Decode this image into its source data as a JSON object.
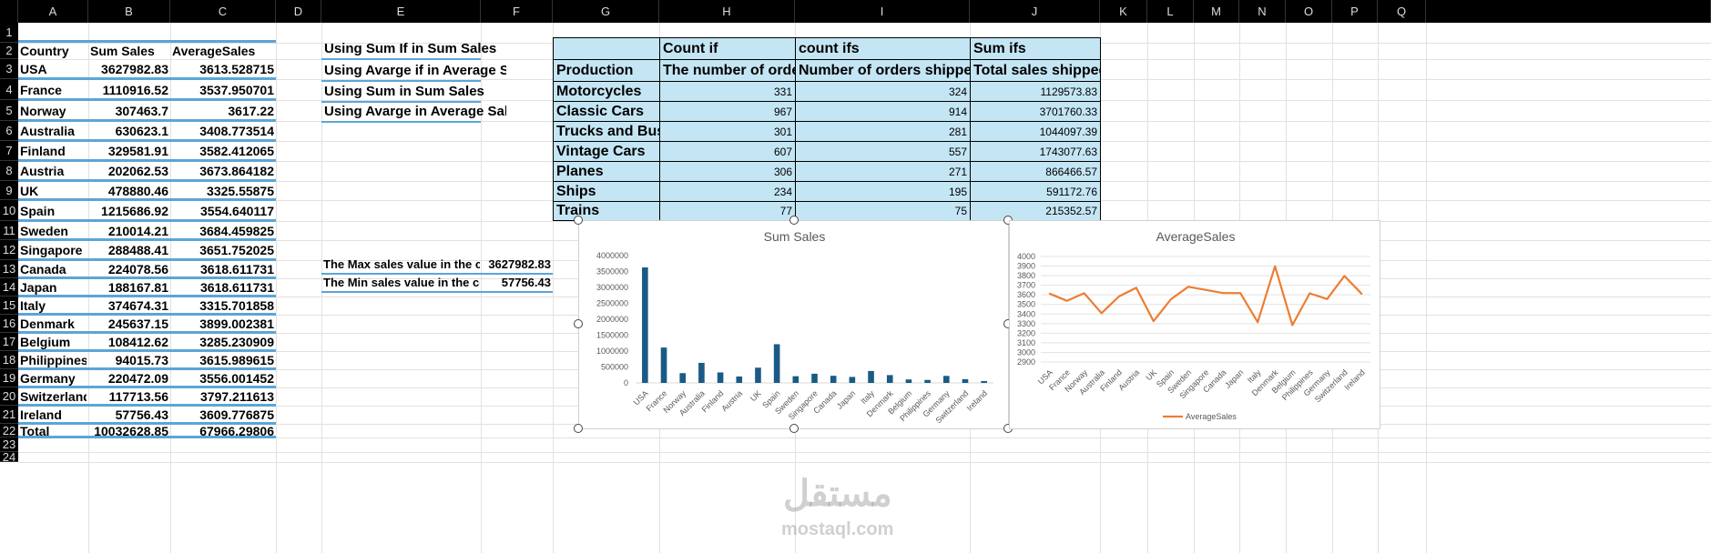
{
  "columns": [
    "A",
    "B",
    "C",
    "D",
    "E",
    "F",
    "G",
    "H",
    "I",
    "J",
    "K",
    "L",
    "M",
    "N",
    "O",
    "P",
    "Q"
  ],
  "rows": [
    "1",
    "2",
    "3",
    "4",
    "5",
    "6",
    "7",
    "8",
    "9",
    "10",
    "11",
    "12",
    "13",
    "14",
    "15",
    "16",
    "17",
    "18",
    "19",
    "20",
    "21",
    "22",
    "23",
    "24"
  ],
  "table_headers": {
    "country": "Country",
    "sum": "Sum Sales",
    "avg": "AverageSales"
  },
  "countries": [
    {
      "name": "USA",
      "sum": "3627982.83",
      "avg": "3613.528715"
    },
    {
      "name": "France",
      "sum": "1110916.52",
      "avg": "3537.950701"
    },
    {
      "name": "Norway",
      "sum": "307463.7",
      "avg": "3617.22"
    },
    {
      "name": "Australia",
      "sum": "630623.1",
      "avg": "3408.773514"
    },
    {
      "name": "Finland",
      "sum": "329581.91",
      "avg": "3582.412065"
    },
    {
      "name": "Austria",
      "sum": "202062.53",
      "avg": "3673.864182"
    },
    {
      "name": "UK",
      "sum": "478880.46",
      "avg": "3325.55875"
    },
    {
      "name": "Spain",
      "sum": "1215686.92",
      "avg": "3554.640117"
    },
    {
      "name": "Sweden",
      "sum": "210014.21",
      "avg": "3684.459825"
    },
    {
      "name": "Singapore",
      "sum": "288488.41",
      "avg": "3651.752025"
    },
    {
      "name": "Canada",
      "sum": "224078.56",
      "avg": "3618.611731"
    },
    {
      "name": "Japan",
      "sum": "188167.81",
      "avg": "3618.611731"
    },
    {
      "name": "Italy",
      "sum": "374674.31",
      "avg": "3315.701858"
    },
    {
      "name": "Denmark",
      "sum": "245637.15",
      "avg": "3899.002381"
    },
    {
      "name": "Belgium",
      "sum": "108412.62",
      "avg": "3285.230909"
    },
    {
      "name": "Philippines",
      "sum": "94015.73",
      "avg": "3615.989615"
    },
    {
      "name": "Germany",
      "sum": "220472.09",
      "avg": "3556.001452"
    },
    {
      "name": "Switzerland",
      "sum": "117713.56",
      "avg": "3797.211613"
    },
    {
      "name": "Ireland",
      "sum": "57756.43",
      "avg": "3609.776875"
    },
    {
      "name": "Total",
      "sum": "10032628.85",
      "avg": "67966.29806"
    }
  ],
  "notes": [
    "Using Sum If in Sum Sales",
    "Using Avarge if in Average Sales",
    "Using Sum in Sum Sales",
    "Using Avarge in Average Sales"
  ],
  "maxmin": [
    {
      "label": "The Max sales value in the country",
      "value": "3627982.83"
    },
    {
      "label": "The Min sales value in the country",
      "value": "57756.43"
    }
  ],
  "production": {
    "header_row1": [
      "",
      "Count if",
      "count ifs",
      "Sum ifs"
    ],
    "header_row2": [
      "Production",
      "The number of order",
      "Number of orders shipped",
      "Total sales shipped"
    ],
    "rows": [
      [
        "Motorcycles",
        "331",
        "324",
        "1129573.83"
      ],
      [
        "Classic Cars",
        "967",
        "914",
        "3701760.33"
      ],
      [
        "Trucks and Buses",
        "301",
        "281",
        "1044097.39"
      ],
      [
        "Vintage Cars",
        "607",
        "557",
        "1743077.63"
      ],
      [
        "Planes",
        "306",
        "271",
        "866466.57"
      ],
      [
        "Ships",
        "234",
        "195",
        "591172.76"
      ],
      [
        "Trains",
        "77",
        "75",
        "215352.57"
      ]
    ]
  },
  "colors": {
    "bar": "#1a5b85",
    "line": "#ed7d31",
    "header_bg": "#000000",
    "table_bg": "#c4e5f4",
    "underline": "#5ba5d8"
  },
  "watermark": {
    "arabic": "مستقل",
    "latin": "mostaql.com"
  },
  "chart_data": [
    {
      "type": "bar",
      "title": "Sum Sales",
      "categories": [
        "USA",
        "France",
        "Norway",
        "Australia",
        "Finland",
        "Austria",
        "UK",
        "Spain",
        "Sweden",
        "Singapore",
        "Canada",
        "Japan",
        "Italy",
        "Denmark",
        "Belgium",
        "Philippines",
        "Germany",
        "Switzerland",
        "Ireland"
      ],
      "values": [
        3627982.83,
        1110916.52,
        307463.7,
        630623.1,
        329581.91,
        202062.53,
        478880.46,
        1215686.92,
        210014.21,
        288488.41,
        224078.56,
        188167.81,
        374674.31,
        245637.15,
        108412.62,
        94015.73,
        220472.09,
        117713.56,
        57756.43
      ],
      "ylim": [
        0,
        4000000
      ],
      "yticks": [
        "0",
        "500000",
        "1000000",
        "1500000",
        "2000000",
        "2500000",
        "3000000",
        "3500000",
        "4000000"
      ],
      "ytick_values": [
        0,
        500000,
        1000000,
        1500000,
        2000000,
        2500000,
        3000000,
        3500000,
        4000000
      ],
      "legend": "none"
    },
    {
      "type": "line",
      "title": "AverageSales",
      "categories": [
        "USA",
        "France",
        "Norway",
        "Australia",
        "Finland",
        "Austria",
        "UK",
        "Spain",
        "Sweden",
        "Singapore",
        "Canada",
        "Japan",
        "Italy",
        "Denmark",
        "Belgium",
        "Philippines",
        "Germany",
        "Switzerland",
        "Ireland"
      ],
      "series": [
        {
          "name": "AverageSales",
          "values": [
            3613.528715,
            3537.950701,
            3617.22,
            3408.773514,
            3582.412065,
            3673.864182,
            3325.55875,
            3554.640117,
            3684.459825,
            3651.752025,
            3618.611731,
            3618.611731,
            3315.701858,
            3899.002381,
            3285.230909,
            3615.989615,
            3556.001452,
            3797.211613,
            3609.776875
          ]
        }
      ],
      "ylim": [
        2900,
        4000
      ],
      "yticks": [
        "2900",
        "3000",
        "3100",
        "3200",
        "3300",
        "3400",
        "3500",
        "3600",
        "3700",
        "3800",
        "3900",
        "4000"
      ],
      "ytick_values": [
        2900,
        3000,
        3100,
        3200,
        3300,
        3400,
        3500,
        3600,
        3700,
        3800,
        3900,
        4000
      ],
      "legend": "bottom",
      "grid": true
    }
  ]
}
